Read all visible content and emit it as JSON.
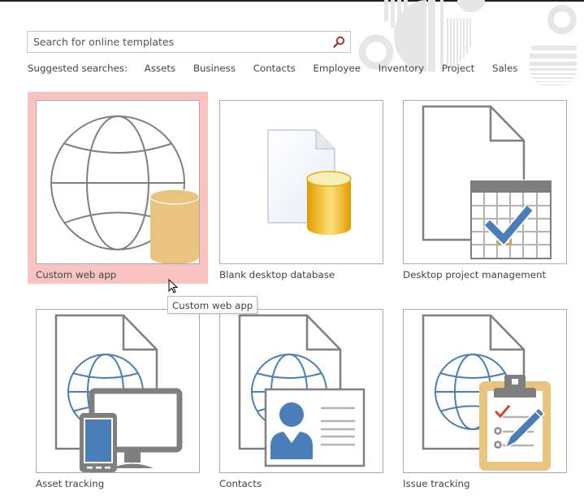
{
  "search": {
    "placeholder": "Search for online templates",
    "value": "",
    "button_icon": "magnifier-icon"
  },
  "suggested": {
    "label": "Suggested searches:",
    "items": [
      "Assets",
      "Business",
      "Contacts",
      "Employee",
      "Inventory",
      "Project",
      "Sales"
    ]
  },
  "templates": [
    {
      "label": "Custom web app",
      "icon": "globe-database-icon",
      "selected": true
    },
    {
      "label": "Blank desktop database",
      "icon": "document-database-icon",
      "selected": false
    },
    {
      "label": "Desktop project management",
      "icon": "document-calendar-check-icon",
      "selected": false
    },
    {
      "label": "Asset tracking",
      "icon": "document-globe-devices-icon",
      "selected": false
    },
    {
      "label": "Contacts",
      "icon": "document-globe-contact-card-icon",
      "selected": false
    },
    {
      "label": "Issue tracking",
      "icon": "document-globe-clipboard-icon",
      "selected": false
    }
  ],
  "tooltip": {
    "text": "Custom web app"
  },
  "colors": {
    "selected_tile": "#f9c3c2",
    "search_icon": "#a4373a",
    "icon_gray": "#808080",
    "icon_blue": "#4a7eb8",
    "icon_gold": "#e8c47f",
    "check_red": "#d24726",
    "calendar_orange": "#e8923a"
  }
}
